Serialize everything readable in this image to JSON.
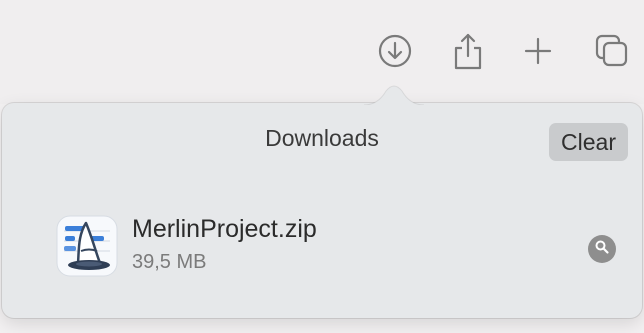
{
  "toolbar": {
    "icons": [
      "download-icon",
      "share-icon",
      "new-tab-icon",
      "tab-overview-icon"
    ]
  },
  "downloads_popover": {
    "title": "Downloads",
    "clear_label": "Clear",
    "items": [
      {
        "file_name": "MerlinProject.zip",
        "file_size": "39,5 MB",
        "icon": "merlin-project-app-icon"
      }
    ]
  },
  "colors": {
    "toolbar_background": "#f0eeef",
    "popover_background": "#e6e8ea",
    "clear_button_background": "#c9cbcd",
    "icon_gray": "#7a7a7a",
    "app_icon_blue": "#3b7fd9"
  }
}
